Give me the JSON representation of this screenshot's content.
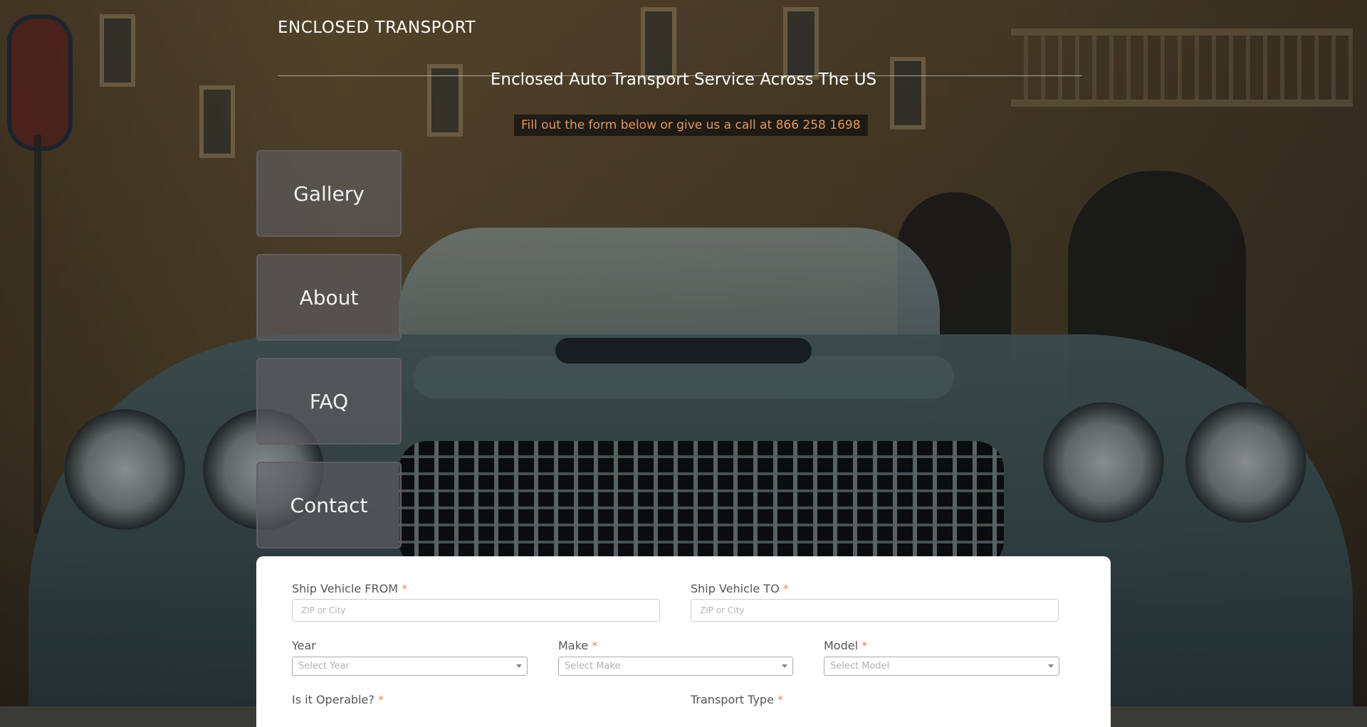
{
  "brand": "ENCLOSED TRANSPORT",
  "tagline": "Enclosed Auto Transport Service Across The US",
  "call_text": "Fill out the form below or give us a call at 866 258 1698",
  "nav": {
    "items": [
      {
        "label": "Gallery"
      },
      {
        "label": "About"
      },
      {
        "label": "FAQ"
      },
      {
        "label": "Contact"
      }
    ]
  },
  "form": {
    "required_mark": "*",
    "from": {
      "label": "Ship Vehicle FROM",
      "placeholder": "ZIP or City"
    },
    "to": {
      "label": "Ship Vehicle TO",
      "placeholder": "ZIP or City"
    },
    "year": {
      "label": "Year",
      "placeholder": "Select Year"
    },
    "make": {
      "label": "Make",
      "placeholder": "Select Make"
    },
    "model": {
      "label": "Model",
      "placeholder": "Select Model"
    },
    "operable": {
      "label": "Is it Operable?"
    },
    "transport_type": {
      "label": "Transport Type"
    }
  },
  "colors": {
    "accent": "#e39a5e",
    "nav_bg": "#5f5f64",
    "form_bg": "#ffffff"
  }
}
